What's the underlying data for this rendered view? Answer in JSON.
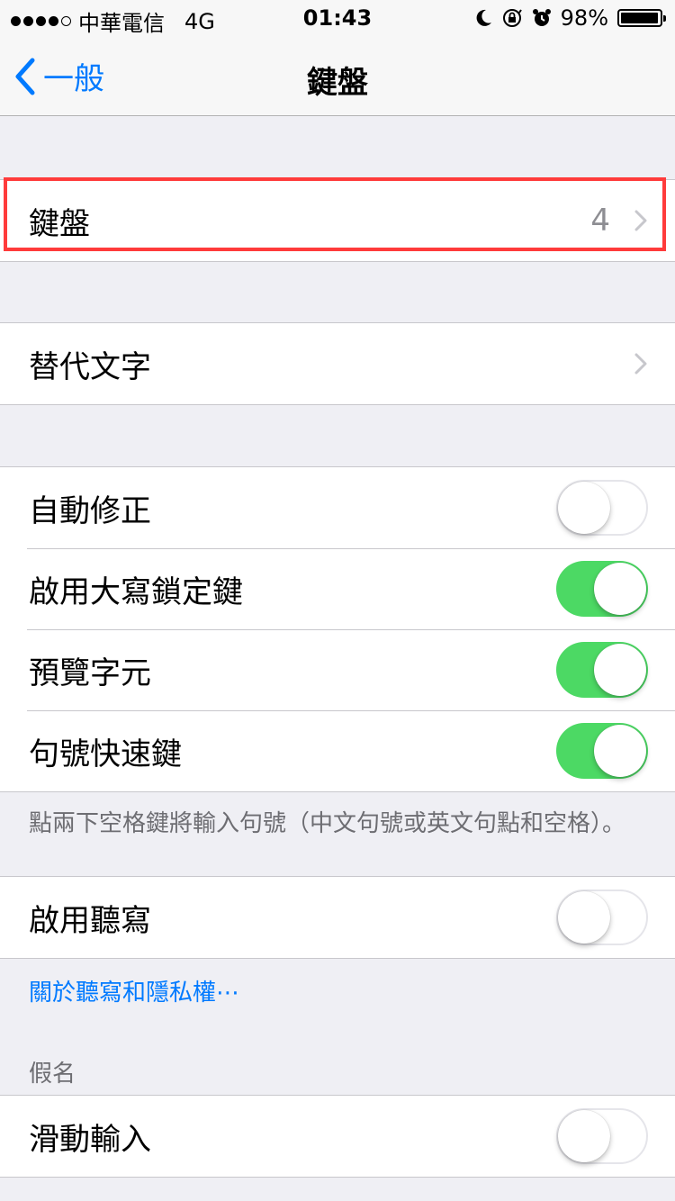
{
  "status_bar": {
    "carrier": "中華電信",
    "network": "4G",
    "time": "01:43",
    "battery": "98%",
    "battery_level": 0.98,
    "icons": [
      "moon-icon",
      "rotation-lock-icon",
      "alarm-icon"
    ]
  },
  "nav": {
    "back_label": "一般",
    "title": "鍵盤"
  },
  "keyboards": {
    "label": "鍵盤",
    "detail": "4"
  },
  "text_replacement": {
    "label": "替代文字"
  },
  "toggles": [
    {
      "label": "自動修正",
      "on": false
    },
    {
      "label": "啟用大寫鎖定鍵",
      "on": true
    },
    {
      "label": "預覽字元",
      "on": true
    },
    {
      "label": "句號快速鍵",
      "on": true
    }
  ],
  "period_shortcut_note": "點兩下空格鍵將輸入句號（中文句號或英文句點和空格）。",
  "dictation": {
    "label": "啟用聽寫",
    "on": false
  },
  "dictation_link": "關於聽寫和隱私權⋯",
  "kana_header": "假名",
  "swipe": {
    "label": "滑動輸入",
    "on": false
  },
  "colors": {
    "accent": "#007aff",
    "toggle_on": "#4cd964",
    "highlight": "#ff3b3b"
  }
}
